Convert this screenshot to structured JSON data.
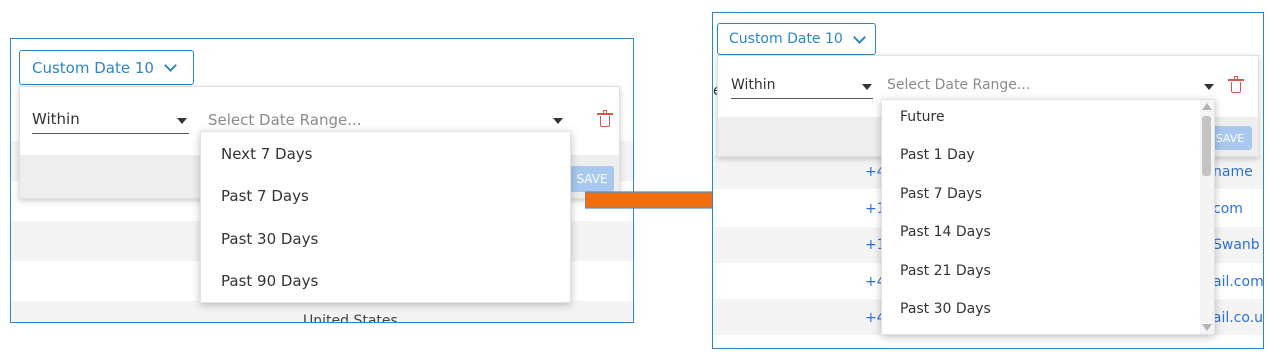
{
  "left": {
    "filter_button_label": "Custom Date 10",
    "within_label": "Within",
    "date_range_placeholder": "Select Date Range...",
    "save_label": "SAVE",
    "options": [
      "Next 7 Days",
      "Past 7 Days",
      "Past 30 Days",
      "Past 90 Days"
    ],
    "background_text": "United States"
  },
  "right": {
    "filter_button_label": "Custom Date 10",
    "within_label": "Within",
    "date_range_placeholder": "Select Date Range...",
    "save_label": "SAVE",
    "options": [
      "Future",
      "Past 1 Day",
      "Past 7 Days",
      "Past 14 Days",
      "Past 21 Days",
      "Past 30 Days"
    ],
    "background": {
      "left_fragment": "e",
      "phones": [
        "+4",
        "+1",
        "+1",
        "+4",
        "+4"
      ],
      "emails": [
        "name",
        "com",
        "Swanb",
        "ail.com",
        "nail.co.u"
      ]
    }
  },
  "colors": {
    "accent": "#2e86c1",
    "arrow": "#f26d0f",
    "delete": "#d9534f",
    "save_disabled": "#a9c8ef",
    "link": "#2e6fd6"
  },
  "icons": [
    "chevron-down-icon",
    "dropdown-caret-icon",
    "trash-icon",
    "arrow-right-icon"
  ]
}
